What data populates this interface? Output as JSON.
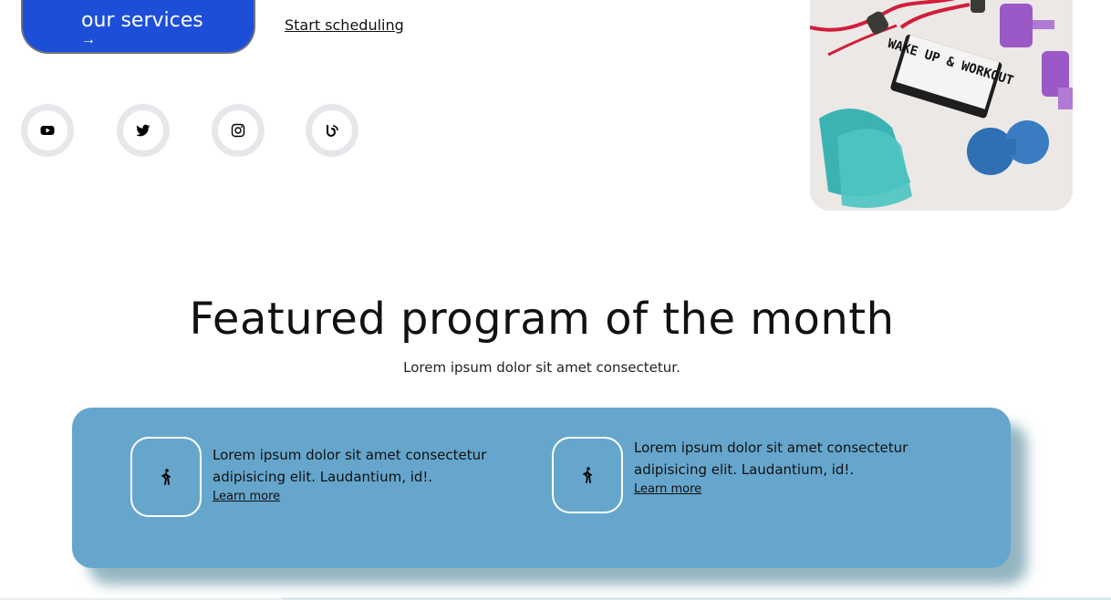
{
  "hero": {
    "cta_label": "our services",
    "cta_arrow": "→",
    "schedule_link": "Start scheduling"
  },
  "social": [
    {
      "icon": "youtube-icon"
    },
    {
      "icon": "twitter-icon"
    },
    {
      "icon": "instagram-icon"
    },
    {
      "icon": "blog-icon"
    }
  ],
  "image": {
    "lightbox_text": "WAKE UP & WORKOUT"
  },
  "featured": {
    "title": "Featured program of the month",
    "subtitle": "Lorem ipsum dolor sit amet consectetur.",
    "programs": [
      {
        "icon": "walking-icon",
        "text": "Lorem ipsum dolor sit amet consectetur adipisicing elit. Laudantium, id!.",
        "link": "Learn more"
      },
      {
        "icon": "walking-icon",
        "text": "Lorem ipsum dolor sit amet consectetur adipisicing elit. Laudantium, id!.",
        "link": "Learn more"
      }
    ]
  },
  "colors": {
    "primary_button": "#1c4ed8",
    "panel": "#66a6cc",
    "social_ring": "#e5e7eb"
  }
}
